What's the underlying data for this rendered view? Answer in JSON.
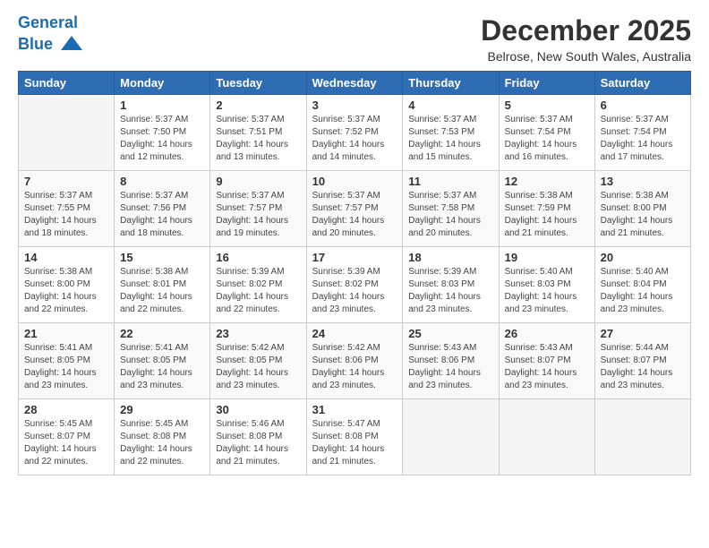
{
  "header": {
    "logo_line1": "General",
    "logo_line2": "Blue",
    "title": "December 2025",
    "subtitle": "Belrose, New South Wales, Australia"
  },
  "days_of_week": [
    "Sunday",
    "Monday",
    "Tuesday",
    "Wednesday",
    "Thursday",
    "Friday",
    "Saturday"
  ],
  "weeks": [
    [
      {
        "day": "",
        "info": ""
      },
      {
        "day": "1",
        "info": "Sunrise: 5:37 AM\nSunset: 7:50 PM\nDaylight: 14 hours\nand 12 minutes."
      },
      {
        "day": "2",
        "info": "Sunrise: 5:37 AM\nSunset: 7:51 PM\nDaylight: 14 hours\nand 13 minutes."
      },
      {
        "day": "3",
        "info": "Sunrise: 5:37 AM\nSunset: 7:52 PM\nDaylight: 14 hours\nand 14 minutes."
      },
      {
        "day": "4",
        "info": "Sunrise: 5:37 AM\nSunset: 7:53 PM\nDaylight: 14 hours\nand 15 minutes."
      },
      {
        "day": "5",
        "info": "Sunrise: 5:37 AM\nSunset: 7:54 PM\nDaylight: 14 hours\nand 16 minutes."
      },
      {
        "day": "6",
        "info": "Sunrise: 5:37 AM\nSunset: 7:54 PM\nDaylight: 14 hours\nand 17 minutes."
      }
    ],
    [
      {
        "day": "7",
        "info": "Sunrise: 5:37 AM\nSunset: 7:55 PM\nDaylight: 14 hours\nand 18 minutes."
      },
      {
        "day": "8",
        "info": "Sunrise: 5:37 AM\nSunset: 7:56 PM\nDaylight: 14 hours\nand 18 minutes."
      },
      {
        "day": "9",
        "info": "Sunrise: 5:37 AM\nSunset: 7:57 PM\nDaylight: 14 hours\nand 19 minutes."
      },
      {
        "day": "10",
        "info": "Sunrise: 5:37 AM\nSunset: 7:57 PM\nDaylight: 14 hours\nand 20 minutes."
      },
      {
        "day": "11",
        "info": "Sunrise: 5:37 AM\nSunset: 7:58 PM\nDaylight: 14 hours\nand 20 minutes."
      },
      {
        "day": "12",
        "info": "Sunrise: 5:38 AM\nSunset: 7:59 PM\nDaylight: 14 hours\nand 21 minutes."
      },
      {
        "day": "13",
        "info": "Sunrise: 5:38 AM\nSunset: 8:00 PM\nDaylight: 14 hours\nand 21 minutes."
      }
    ],
    [
      {
        "day": "14",
        "info": "Sunrise: 5:38 AM\nSunset: 8:00 PM\nDaylight: 14 hours\nand 22 minutes."
      },
      {
        "day": "15",
        "info": "Sunrise: 5:38 AM\nSunset: 8:01 PM\nDaylight: 14 hours\nand 22 minutes."
      },
      {
        "day": "16",
        "info": "Sunrise: 5:39 AM\nSunset: 8:02 PM\nDaylight: 14 hours\nand 22 minutes."
      },
      {
        "day": "17",
        "info": "Sunrise: 5:39 AM\nSunset: 8:02 PM\nDaylight: 14 hours\nand 23 minutes."
      },
      {
        "day": "18",
        "info": "Sunrise: 5:39 AM\nSunset: 8:03 PM\nDaylight: 14 hours\nand 23 minutes."
      },
      {
        "day": "19",
        "info": "Sunrise: 5:40 AM\nSunset: 8:03 PM\nDaylight: 14 hours\nand 23 minutes."
      },
      {
        "day": "20",
        "info": "Sunrise: 5:40 AM\nSunset: 8:04 PM\nDaylight: 14 hours\nand 23 minutes."
      }
    ],
    [
      {
        "day": "21",
        "info": "Sunrise: 5:41 AM\nSunset: 8:05 PM\nDaylight: 14 hours\nand 23 minutes."
      },
      {
        "day": "22",
        "info": "Sunrise: 5:41 AM\nSunset: 8:05 PM\nDaylight: 14 hours\nand 23 minutes."
      },
      {
        "day": "23",
        "info": "Sunrise: 5:42 AM\nSunset: 8:05 PM\nDaylight: 14 hours\nand 23 minutes."
      },
      {
        "day": "24",
        "info": "Sunrise: 5:42 AM\nSunset: 8:06 PM\nDaylight: 14 hours\nand 23 minutes."
      },
      {
        "day": "25",
        "info": "Sunrise: 5:43 AM\nSunset: 8:06 PM\nDaylight: 14 hours\nand 23 minutes."
      },
      {
        "day": "26",
        "info": "Sunrise: 5:43 AM\nSunset: 8:07 PM\nDaylight: 14 hours\nand 23 minutes."
      },
      {
        "day": "27",
        "info": "Sunrise: 5:44 AM\nSunset: 8:07 PM\nDaylight: 14 hours\nand 23 minutes."
      }
    ],
    [
      {
        "day": "28",
        "info": "Sunrise: 5:45 AM\nSunset: 8:07 PM\nDaylight: 14 hours\nand 22 minutes."
      },
      {
        "day": "29",
        "info": "Sunrise: 5:45 AM\nSunset: 8:08 PM\nDaylight: 14 hours\nand 22 minutes."
      },
      {
        "day": "30",
        "info": "Sunrise: 5:46 AM\nSunset: 8:08 PM\nDaylight: 14 hours\nand 21 minutes."
      },
      {
        "day": "31",
        "info": "Sunrise: 5:47 AM\nSunset: 8:08 PM\nDaylight: 14 hours\nand 21 minutes."
      },
      {
        "day": "",
        "info": ""
      },
      {
        "day": "",
        "info": ""
      },
      {
        "day": "",
        "info": ""
      }
    ]
  ]
}
